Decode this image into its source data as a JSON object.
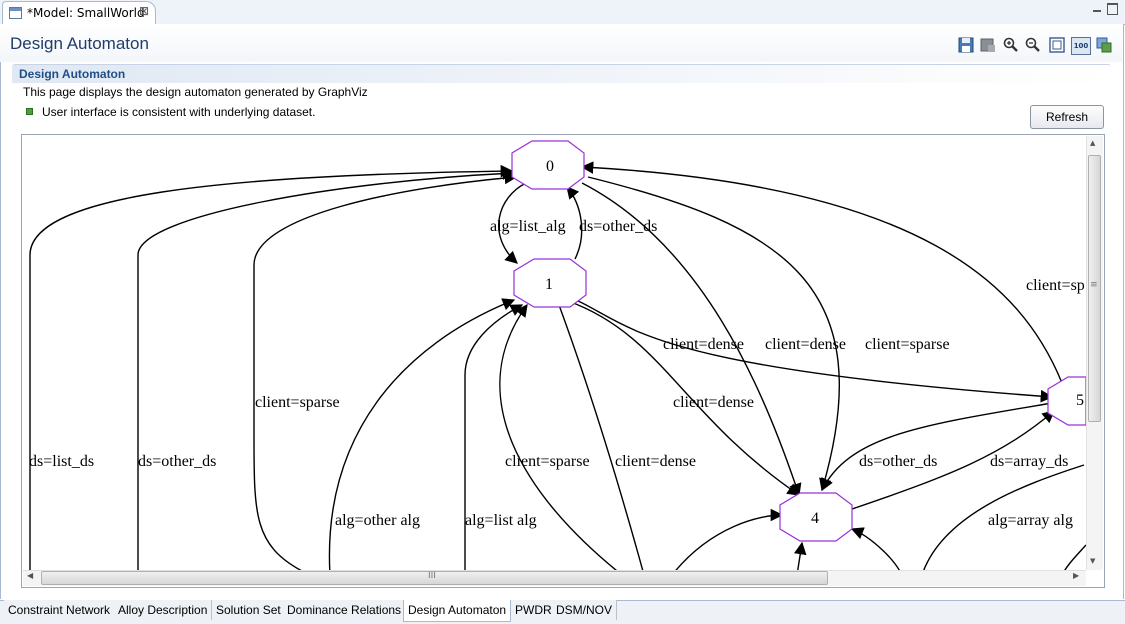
{
  "editor_tab": {
    "title": "*Model: SmallWorld",
    "close": "⊠"
  },
  "header": {
    "title": "Design Automaton",
    "toolbar": [
      {
        "name": "save-icon"
      },
      {
        "name": "export-icon"
      },
      {
        "name": "zoom-in-icon"
      },
      {
        "name": "zoom-out-icon"
      },
      {
        "name": "fit-to-window-icon"
      },
      {
        "name": "zoom-100-icon",
        "label": "100"
      },
      {
        "name": "layout-icon"
      }
    ]
  },
  "section": {
    "title": "Design Automaton",
    "description": "This page displays the design automaton generated by GraphViz",
    "status": "User interface is consistent with underlying dataset.",
    "status_color": "#4f9e3a",
    "refresh_label": "Refresh"
  },
  "graph": {
    "node_color": "#9b30d9",
    "nodes": [
      "0",
      "1",
      "4",
      "5"
    ],
    "edge_labels": {
      "alg_list_alg": "alg=list_alg",
      "ds_other_ds_top": "ds=other_ds",
      "client_sp_right": "client=sp",
      "client_dense_a": "client=dense",
      "client_dense_b": "client=dense",
      "client_sparse_top": "client=sparse",
      "client_sparse_left": "client=sparse",
      "client_dense_mid": "client=dense",
      "ds_list_ds": "ds=list_ds",
      "ds_other_ds_left": "ds=other_ds",
      "ds_other_ds_right": "ds=other_ds",
      "ds_array_ds": "ds=array_ds",
      "client_sparse_low": "client=sparse",
      "client_dense_low": "client=dense",
      "alg_other_alg": "alg=other  alg",
      "alg_list_alg_low": "alg=list  alg",
      "alg_array_alg": "alg=array  alg"
    }
  },
  "scrollbars": {
    "grip": "≡",
    "hgrip": "III"
  },
  "page_tabs": [
    {
      "label": "Constraint Network",
      "active": false
    },
    {
      "label": "Alloy Description",
      "active": false
    },
    {
      "label": "Solution Set",
      "active": false
    },
    {
      "label": "Dominance Relations",
      "active": false
    },
    {
      "label": "Design Automaton",
      "active": true
    },
    {
      "label": "PWDR",
      "active": false
    },
    {
      "label": "DSM/NOV",
      "active": false
    }
  ]
}
